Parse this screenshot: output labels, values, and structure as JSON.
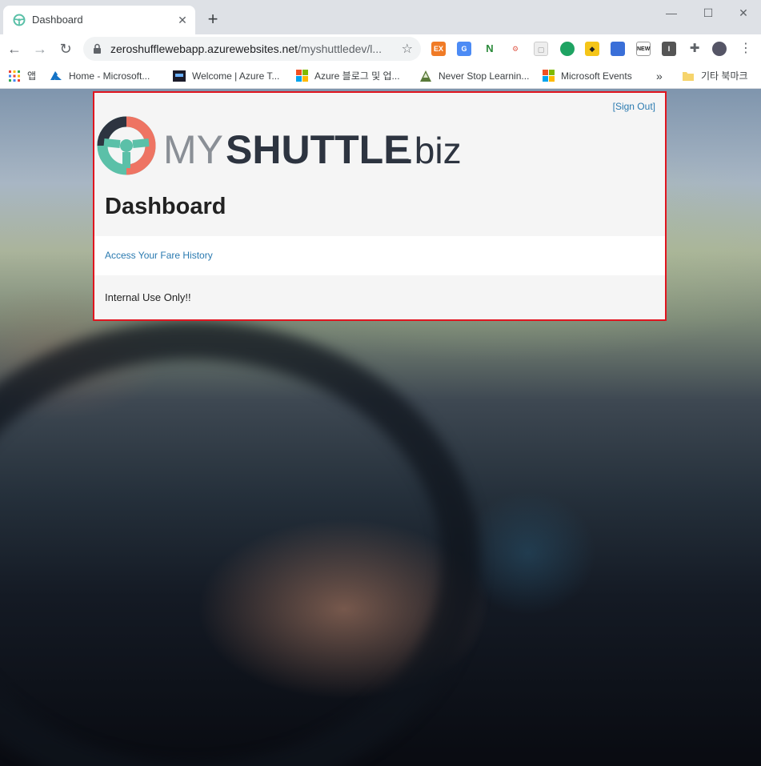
{
  "browser": {
    "tab_title": "Dashboard",
    "tab_close": "✕",
    "new_tab": "+",
    "url_host": "zeroshufflewebapp.azurewebsites.net",
    "url_path": "/myshuttledev/l...",
    "extensions": [
      "EX",
      "G",
      "N",
      "3",
      "2d",
      "NEW",
      "I"
    ],
    "bookmarks": [
      "앱",
      "Home - Microsoft...",
      "Welcome | Azure T...",
      "Azure 블로그 및 업...",
      "Never Stop Learnin...",
      "Microsoft Events"
    ],
    "more_bookmarks": "»",
    "other_bookmarks": "기타 북마크"
  },
  "page": {
    "sign_out": "[Sign Out]",
    "logo": {
      "my": "MY",
      "shuttle": "SHUTTLE",
      "biz": ".biz"
    },
    "heading": "Dashboard",
    "fare_link": "Access Your Fare History",
    "internal_note": "Internal Use Only!!"
  },
  "colors": {
    "accent_link": "#2a7ab0",
    "highlight_border": "#e0151f",
    "logo_teal": "#5bc0a8",
    "logo_coral": "#ee7463",
    "logo_dark": "#2d3440"
  }
}
